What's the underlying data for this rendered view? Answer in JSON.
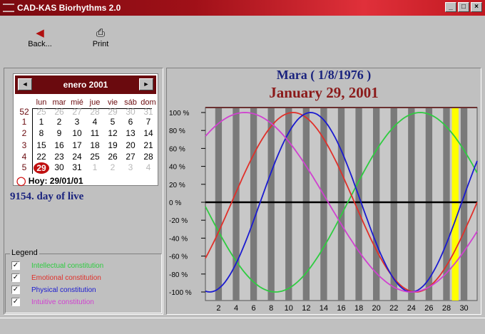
{
  "window": {
    "title": "CAD-KAS Biorhythms 2.0",
    "min": "_",
    "max": "□",
    "close": "×"
  },
  "toolbar": {
    "back": "Back...",
    "print": "Print"
  },
  "calendar": {
    "month": "enero 2001",
    "prev": "◄",
    "next": "►",
    "dows": [
      "lun",
      "mar",
      "mié",
      "jue",
      "vie",
      "sáb",
      "dom"
    ],
    "weeks": [
      {
        "wk": "52",
        "days": [
          [
            "25",
            1
          ],
          [
            "26",
            1
          ],
          [
            "27",
            1
          ],
          [
            "28",
            1
          ],
          [
            "29",
            1
          ],
          [
            "30",
            1
          ],
          [
            "31",
            1
          ]
        ]
      },
      {
        "wk": "1",
        "days": [
          [
            "1",
            0
          ],
          [
            "2",
            0
          ],
          [
            "3",
            0
          ],
          [
            "4",
            0
          ],
          [
            "5",
            0
          ],
          [
            "6",
            0
          ],
          [
            "7",
            0
          ]
        ]
      },
      {
        "wk": "2",
        "days": [
          [
            "8",
            0
          ],
          [
            "9",
            0
          ],
          [
            "10",
            0
          ],
          [
            "11",
            0
          ],
          [
            "12",
            0
          ],
          [
            "13",
            0
          ],
          [
            "14",
            0
          ]
        ]
      },
      {
        "wk": "3",
        "days": [
          [
            "15",
            0
          ],
          [
            "16",
            0
          ],
          [
            "17",
            0
          ],
          [
            "18",
            0
          ],
          [
            "19",
            0
          ],
          [
            "20",
            0
          ],
          [
            "21",
            0
          ]
        ]
      },
      {
        "wk": "4",
        "days": [
          [
            "22",
            0
          ],
          [
            "23",
            0
          ],
          [
            "24",
            0
          ],
          [
            "25",
            0
          ],
          [
            "26",
            0
          ],
          [
            "27",
            0
          ],
          [
            "28",
            0
          ]
        ]
      },
      {
        "wk": "5",
        "days": [
          [
            "29",
            2
          ],
          [
            "30",
            0
          ],
          [
            "31",
            0
          ],
          [
            "1",
            1
          ],
          [
            "2",
            1
          ],
          [
            "3",
            1
          ],
          [
            "4",
            1
          ]
        ]
      }
    ],
    "today": "Hoy: 29/01/01"
  },
  "days_alive": "9154. day of live",
  "legend": {
    "title": "Legend",
    "items": [
      {
        "label": "Intellectual constitution",
        "color": "#2ecc40",
        "checked": true
      },
      {
        "label": "Emotional constitution",
        "color": "#e0302a",
        "checked": true
      },
      {
        "label": "Physical constitution",
        "color": "#1a1ad0",
        "checked": true
      },
      {
        "label": "Intuitive constitution",
        "color": "#d040d0",
        "checked": true
      }
    ]
  },
  "chart_data": {
    "type": "line",
    "title": "Mara ( 1/8/1976 )",
    "subtitle": "January 29, 2001",
    "xlim": [
      0.5,
      31.5
    ],
    "ylim": [
      -100,
      100
    ],
    "xticks": [
      "2",
      "4",
      "6",
      "8",
      "10",
      "12",
      "14",
      "16",
      "18",
      "20",
      "22",
      "24",
      "26",
      "28",
      "30"
    ],
    "yticks": [
      "100 %",
      "80 %",
      "60 %",
      "40 %",
      "20 %",
      "0 %",
      "-20 %",
      "-40 %",
      "-60 %",
      "-80 %",
      "-100 %"
    ],
    "highlight_day": 29,
    "series": [
      {
        "name": "Intellectual constitution",
        "color": "#2ecc40",
        "period_days": 33,
        "peak_day": 25
      },
      {
        "name": "Emotional constitution",
        "color": "#e0302a",
        "period_days": 28,
        "peak_day": 10.5
      },
      {
        "name": "Physical constitution",
        "color": "#1a1ad0",
        "period_days": 23,
        "peak_day": 12.5
      },
      {
        "name": "Intuitive constitution",
        "color": "#d040d0",
        "period_days": 38,
        "peak_day": 5
      }
    ]
  }
}
